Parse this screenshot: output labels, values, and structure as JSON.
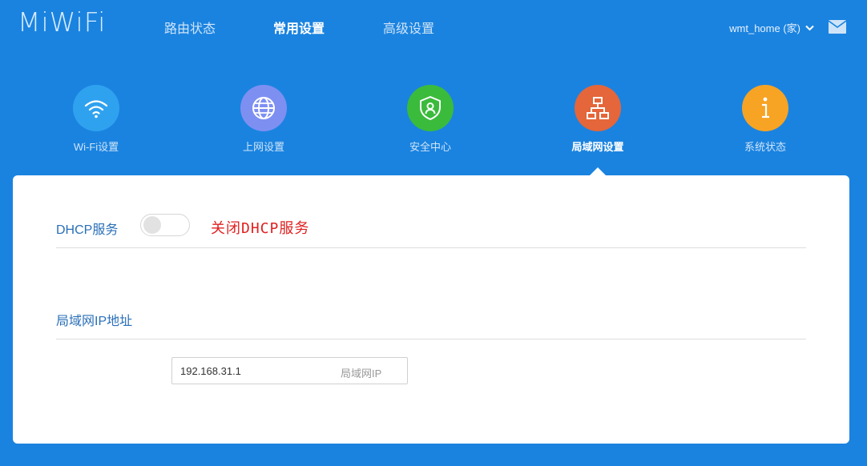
{
  "header": {
    "logo": "MiWiFi",
    "nav": [
      {
        "label": "路由状态",
        "active": false
      },
      {
        "label": "常用设置",
        "active": true
      },
      {
        "label": "高级设置",
        "active": false
      }
    ],
    "user": "wmt_home (家)"
  },
  "tiles": [
    {
      "label": "Wi-Fi设置",
      "icon": "wifi-icon",
      "color": "#2fa2ef"
    },
    {
      "label": "上网设置",
      "icon": "globe-icon",
      "color": "#7e8ff2"
    },
    {
      "label": "安全中心",
      "icon": "shield-icon",
      "color": "#3bbb3b"
    },
    {
      "label": "局域网设置",
      "icon": "lan-network-icon",
      "color": "#e4663a",
      "active": true
    },
    {
      "label": "系统状态",
      "icon": "info-icon",
      "color": "#f7a324"
    }
  ],
  "panel": {
    "dhcp": {
      "label": "DHCP服务",
      "enabled": false,
      "annotation": "关闭DHCP服务"
    },
    "lan_ip": {
      "section_label": "局域网IP地址",
      "value": "192.168.31.1",
      "hint": "局域网IP"
    }
  },
  "colors": {
    "background": "#1a83e0",
    "annotation": "#e02020",
    "label_blue": "#2a6fb8"
  }
}
